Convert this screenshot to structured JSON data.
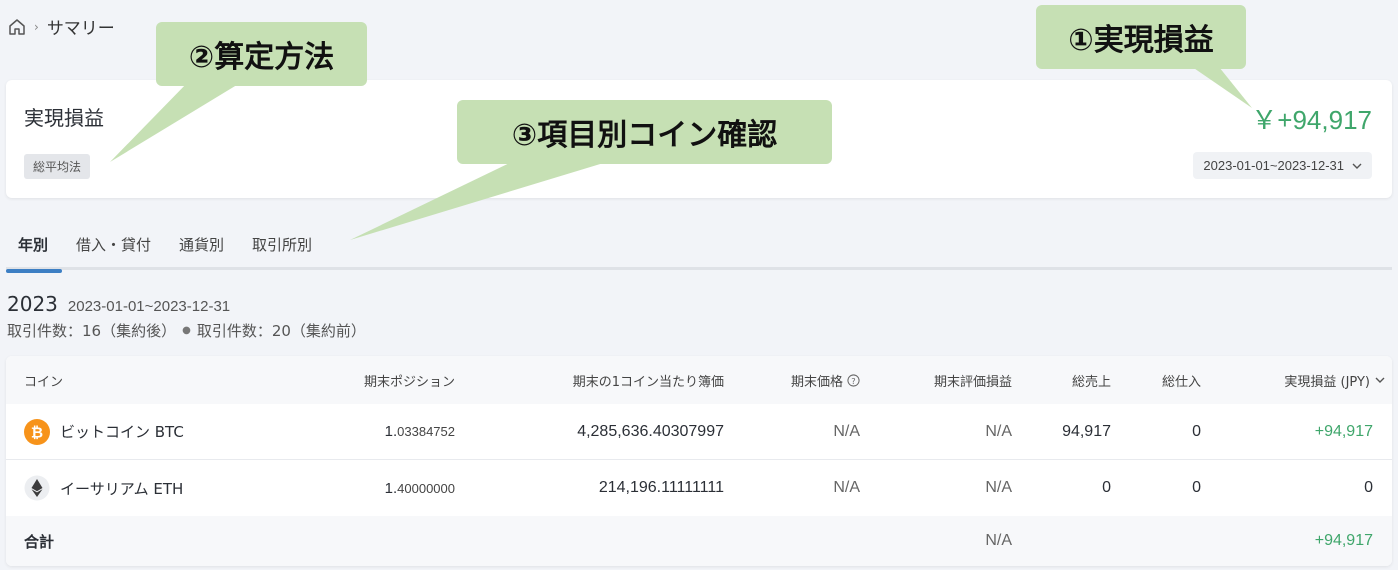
{
  "breadcrumb": {
    "separator": "›",
    "current": "サマリー"
  },
  "summary": {
    "title": "実現損益",
    "method": "総平均法",
    "total_pnl": "￥+94,917",
    "period": "2023-01-01~2023-12-31"
  },
  "tabs": [
    {
      "label": "年別",
      "active": true
    },
    {
      "label": "借入・貸付",
      "active": false
    },
    {
      "label": "通貨別",
      "active": false
    },
    {
      "label": "取引所別",
      "active": false
    }
  ],
  "year": {
    "label": "2023",
    "range": "2023-01-01~2023-12-31",
    "count_after": "取引件数：16（集約後）",
    "count_before": "取引件数：20（集約前）"
  },
  "table": {
    "headers": {
      "coin": "コイン",
      "end_position": "期末ポジション",
      "unit_book_value": "期末の1コイン当たり簿価",
      "end_price": "期末価格",
      "end_unrealized": "期末評価損益",
      "total_sales": "総売上",
      "total_purchase": "総仕入",
      "realized_pnl": "実現損益 (JPY)"
    },
    "rows": [
      {
        "coin": "ビットコイン BTC",
        "icon": "bitcoin-icon",
        "position_int": "1.",
        "position_frac": "03384752",
        "unit_book_value": "4,285,636.40307997",
        "end_price": "N/A",
        "end_unrealized": "N/A",
        "total_sales": "94,917",
        "total_purchase": "0",
        "realized_pnl": "+94,917"
      },
      {
        "coin": "イーサリアム ETH",
        "icon": "ethereum-icon",
        "position_int": "1.",
        "position_frac": "40000000",
        "unit_book_value": "214,196.11111111",
        "end_price": "N/A",
        "end_unrealized": "N/A",
        "total_sales": "0",
        "total_purchase": "0",
        "realized_pnl": "0"
      }
    ],
    "total": {
      "label": "合計",
      "end_unrealized": "N/A",
      "realized_pnl": "+94,917"
    }
  },
  "callouts": {
    "c1": "①実現損益",
    "c2": "②算定方法",
    "c3": "③項目別コイン確認"
  },
  "colors": {
    "positive": "#3fa66b",
    "tab_active": "#3d7fc4",
    "callout_bg": "#c6e0b4",
    "bitcoin": "#f7931a"
  }
}
